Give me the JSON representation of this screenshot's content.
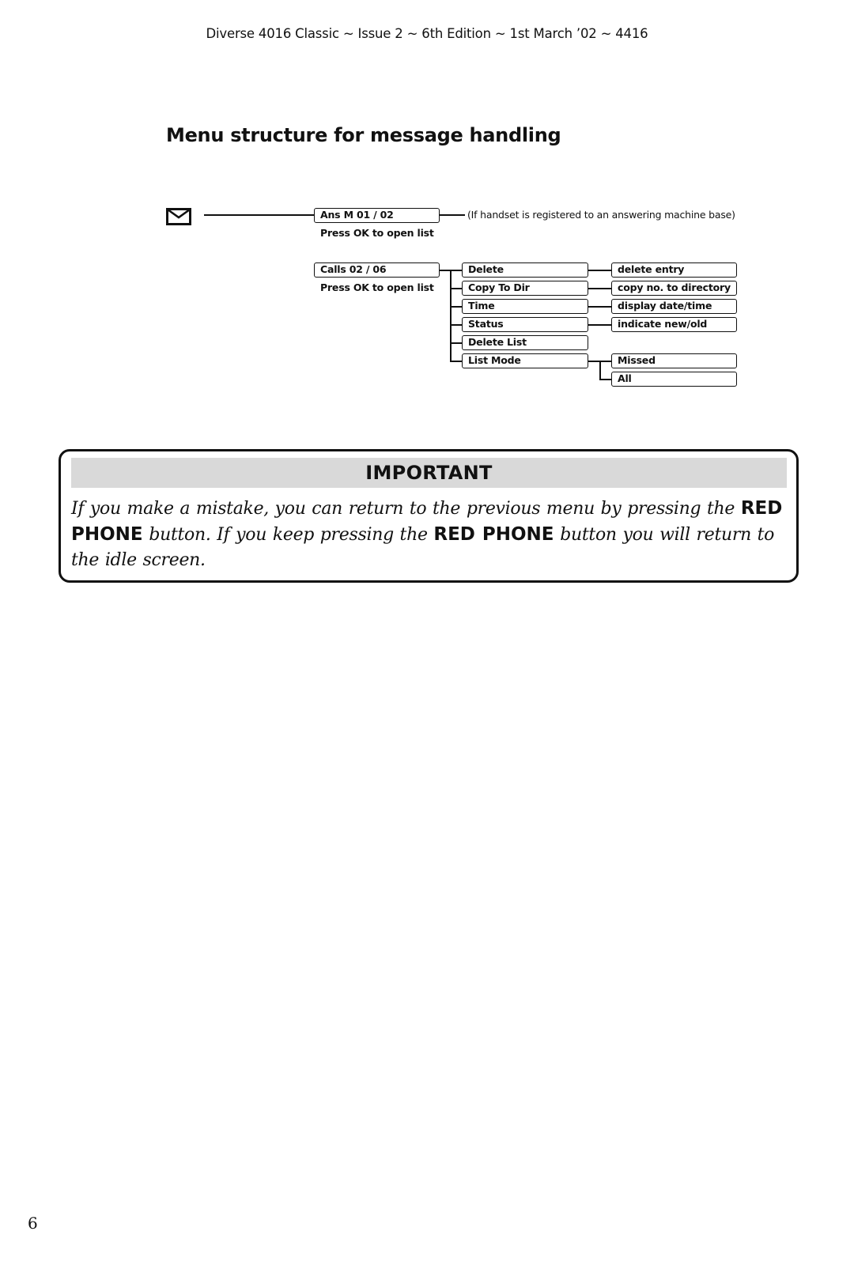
{
  "header": {
    "running_title": "Diverse 4016 Classic ~ Issue 2 ~ 6th Edition ~ 1st March ’02 ~ 4416"
  },
  "section": {
    "title": "Menu structure for message handling",
    "root_icon": "envelope-icon"
  },
  "menu": {
    "answering_machine": {
      "label": "Ans M 01 / 02",
      "hint": "Press OK to open list",
      "note": "(If handset is registered to an answering machine base)"
    },
    "calls": {
      "label": "Calls 02 / 06",
      "hint": "Press OK to open list",
      "options": [
        {
          "label": "Delete",
          "detail": "delete entry"
        },
        {
          "label": "Copy To Dir",
          "detail": "copy no. to directory"
        },
        {
          "label": "Time",
          "detail": "display date/time"
        },
        {
          "label": "Status",
          "detail": "indicate new/old"
        },
        {
          "label": "Delete List"
        },
        {
          "label": "List Mode",
          "sub_options": [
            "Missed",
            "All"
          ]
        }
      ]
    }
  },
  "important": {
    "heading": "IMPORTANT",
    "body": {
      "part1": "If you make a mistake, you can return to the previous menu by pressing the ",
      "bold1": "RED PHONE",
      "part2": " button. If you keep pressing the ",
      "bold2": "RED PHONE",
      "part3": " button you will return to the idle screen."
    },
    "heading_bg": "#d9d9d9"
  },
  "footer": {
    "page_number": "6"
  }
}
